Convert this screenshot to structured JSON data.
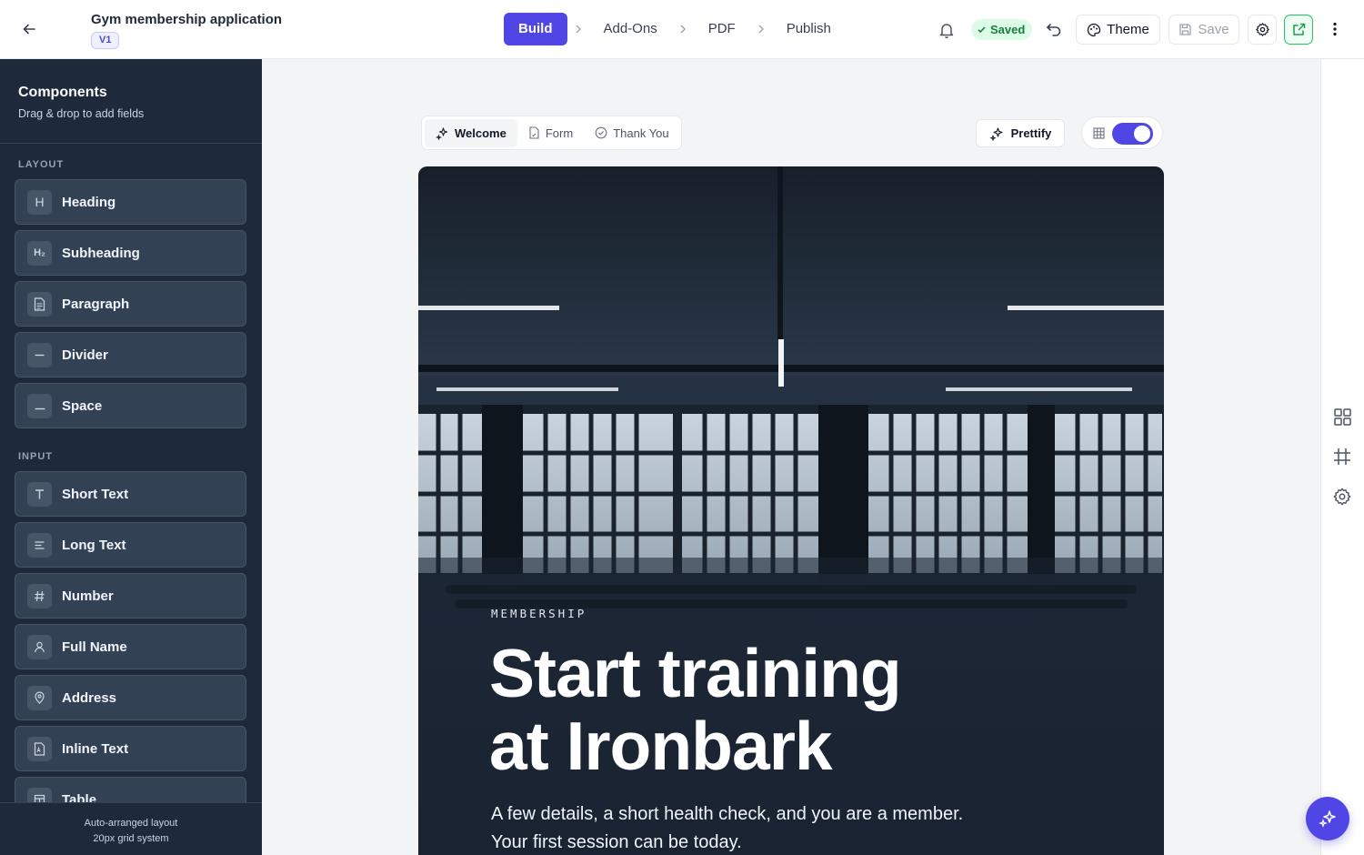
{
  "header": {
    "title": "Gym membership application",
    "version": "V1",
    "steps": [
      "Build",
      "Add-Ons",
      "PDF",
      "Publish"
    ],
    "saved_label": "Saved",
    "theme_label": "Theme",
    "save_label": "Save"
  },
  "sidebar": {
    "title": "Components",
    "subtitle": "Drag & drop to add fields",
    "layout_section": "LAYOUT",
    "layout_items": [
      {
        "label": "Heading",
        "icon": "H"
      },
      {
        "label": "Subheading",
        "icon": "H₂"
      },
      {
        "label": "Paragraph",
        "icon": "paragraph-icon"
      },
      {
        "label": "Divider",
        "icon": "divider-icon"
      },
      {
        "label": "Space",
        "icon": "space-icon"
      }
    ],
    "input_section": "INPUT",
    "input_items": [
      {
        "label": "Short Text",
        "icon": "T"
      },
      {
        "label": "Long Text",
        "icon": "long-text-icon"
      },
      {
        "label": "Number",
        "icon": "#"
      },
      {
        "label": "Full Name",
        "icon": "user-icon"
      },
      {
        "label": "Address",
        "icon": "map-pin-icon"
      },
      {
        "label": "Inline Text",
        "icon": "inline-text-icon"
      },
      {
        "label": "Table",
        "icon": "table-icon"
      }
    ],
    "footer_line1": "Auto-arranged layout",
    "footer_line2": "20px grid system"
  },
  "canvas": {
    "tabs": [
      "Welcome",
      "Form",
      "Thank You"
    ],
    "active_tab": "Welcome",
    "prettify_label": "Prettify",
    "grid_toggle_on": true
  },
  "hero": {
    "eyebrow": "MEMBERSHIP",
    "headline_line1": "Start training",
    "headline_line2": "at Ironbark",
    "sub_line1": "A few details, a short health check, and you are a member.",
    "sub_line2": "Your first session can be today."
  },
  "colors": {
    "accent": "#4f46e5",
    "sidebar_bg": "#1e293b",
    "saved_green": "#15803d"
  }
}
